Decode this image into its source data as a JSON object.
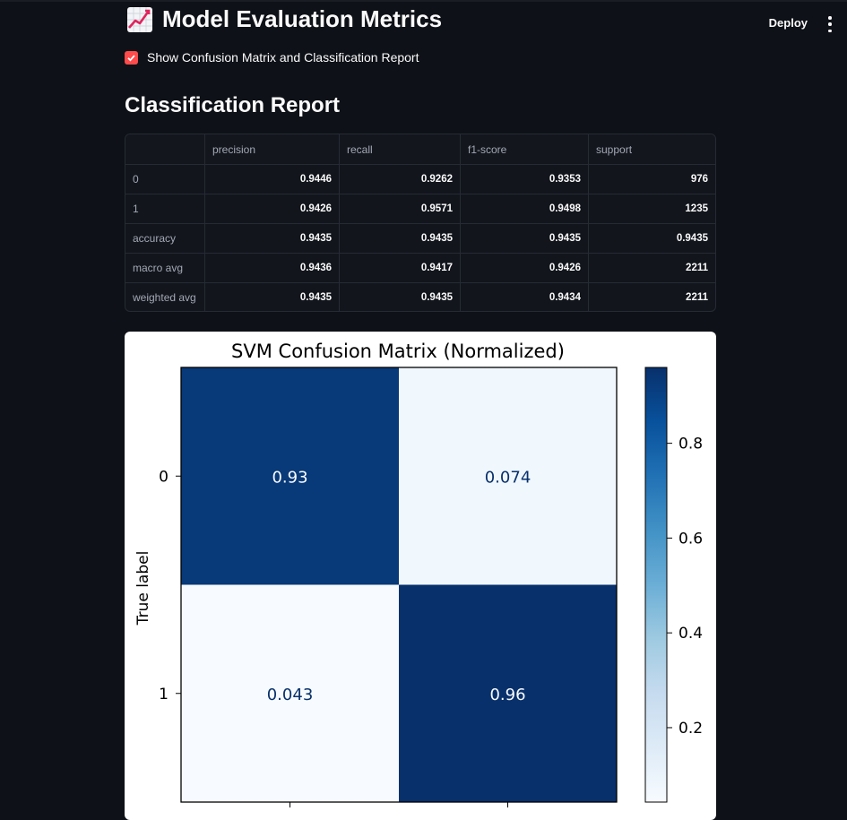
{
  "header": {
    "title": "Model Evaluation Metrics",
    "title_icon": "chart-increasing-icon",
    "deploy_label": "Deploy",
    "menu_icon": "vertical-ellipsis-icon"
  },
  "options": {
    "show_report_label": "Show Confusion Matrix and Classification Report",
    "show_report_checked": true
  },
  "report": {
    "title": "Classification Report",
    "columns": [
      "",
      "precision",
      "recall",
      "f1-score",
      "support"
    ],
    "rows": [
      {
        "label": "0",
        "values": [
          "0.9446",
          "0.9262",
          "0.9353",
          "976"
        ]
      },
      {
        "label": "1",
        "values": [
          "0.9426",
          "0.9571",
          "0.9498",
          "1235"
        ]
      },
      {
        "label": "accuracy",
        "values": [
          "0.9435",
          "0.9435",
          "0.9435",
          "0.9435"
        ]
      },
      {
        "label": "macro avg",
        "values": [
          "0.9436",
          "0.9417",
          "0.9426",
          "2211"
        ]
      },
      {
        "label": "weighted avg",
        "values": [
          "0.9435",
          "0.9435",
          "0.9434",
          "2211"
        ]
      }
    ]
  },
  "colors": {
    "accent": "#ff4b4b",
    "background": "#0e1117",
    "heat_dark": "#08306b",
    "heat_light": "#f7fbff"
  },
  "chart_data": {
    "type": "heatmap",
    "title": "SVM Confusion Matrix (Normalized)",
    "ylabel": "True label",
    "xlabel": "",
    "row_labels": [
      "0",
      "1"
    ],
    "matrix": [
      [
        0.93,
        0.074
      ],
      [
        0.043,
        0.96
      ]
    ],
    "cell_labels": [
      [
        "0.93",
        "0.074"
      ],
      [
        "0.043",
        "0.96"
      ]
    ],
    "colorbar": {
      "ticks": [
        "0.2",
        "0.4",
        "0.6",
        "0.8"
      ],
      "tick_values": [
        0.2,
        0.4,
        0.6,
        0.8
      ],
      "range": [
        0.043,
        0.96
      ],
      "cmap": "Blues"
    }
  }
}
